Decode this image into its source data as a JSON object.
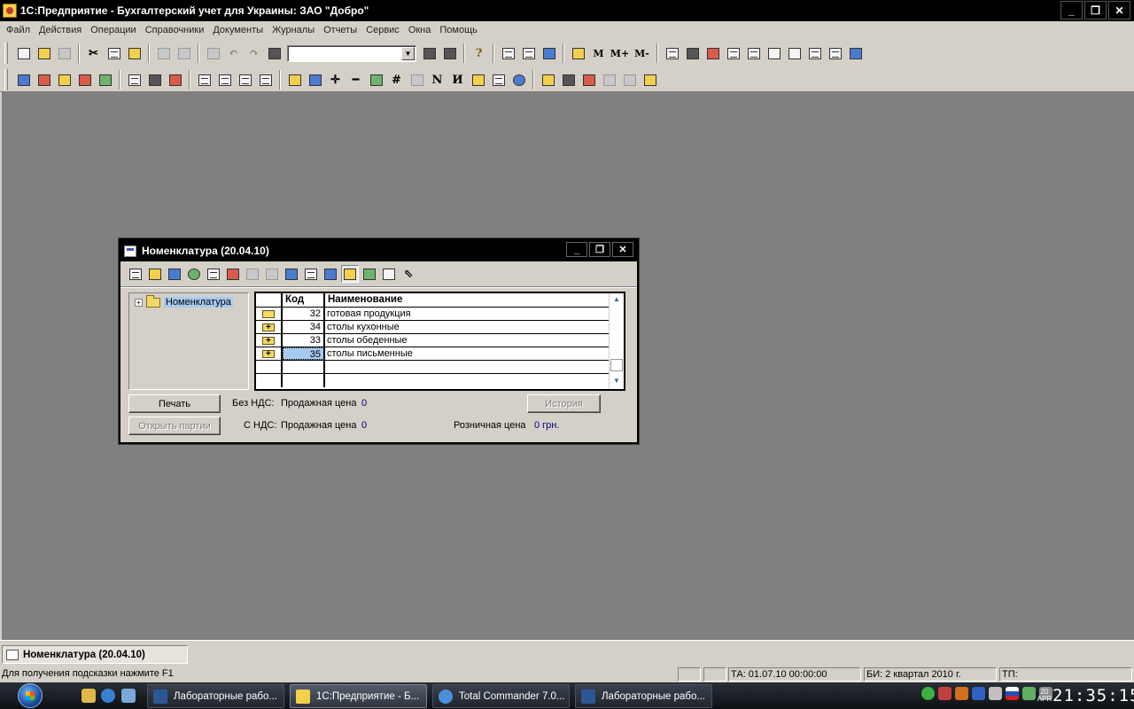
{
  "app": {
    "title": "1С:Предприятие - Бухгалтерский учет для Украины: ЗАО \"Добро\"",
    "window_buttons": [
      "_",
      "❐",
      "✕"
    ]
  },
  "menu": [
    "Файл",
    "Действия",
    "Операции",
    "Справочники",
    "Документы",
    "Журналы",
    "Отчеты",
    "Сервис",
    "Окна",
    "Помощь"
  ],
  "toolbar": {
    "m_buttons": [
      "M",
      "M+",
      "M-"
    ],
    "help_glyph": "?",
    "search_value": ""
  },
  "child_window": {
    "title": "Номенклатура (20.04.10)",
    "buttons": [
      "_",
      "❐",
      "✕"
    ],
    "tree": {
      "expander": "+",
      "root_label": "Номенклатура"
    },
    "grid": {
      "headers": [
        "",
        "Код",
        "Наименование"
      ],
      "rows": [
        {
          "icon": "open-folder-icon",
          "code": "32",
          "name": "готовая продукция"
        },
        {
          "icon": "folder-plus-icon",
          "code": "34",
          "name": "столы кухонные"
        },
        {
          "icon": "folder-plus-icon",
          "code": "33",
          "name": "столы обеденные"
        },
        {
          "icon": "folder-plus-icon",
          "code": "35",
          "name": "столы письменные"
        }
      ]
    },
    "buttons_bottom": {
      "print": "Печать",
      "open_batches": "Открыть партии",
      "history": "История"
    },
    "info": {
      "no_vat_label": "Без НДС:",
      "with_vat_label": "С НДС:",
      "sale_price_label": "Продажная цена",
      "no_vat_value": "0",
      "with_vat_value": "0",
      "retail_label": "Розничная цена",
      "retail_value": "0 грн."
    }
  },
  "mdi_tab": "Номенклатура (20.04.10)",
  "statusbar": {
    "hint": "Для получения подсказки нажмите F1",
    "ta": "ТА: 01.07.10  00:00:00",
    "bi": "БИ: 2 квартал 2010 г.",
    "tp": "ТП:"
  },
  "taskbar": {
    "tasks": [
      {
        "label": "Лабораторные рабо...",
        "active": false
      },
      {
        "label": "1С:Предприятие - Б...",
        "active": true
      },
      {
        "label": "Total Commander 7.0...",
        "active": false
      },
      {
        "label": "Лабораторные рабо...",
        "active": false
      }
    ],
    "clock_date": "20 APR",
    "clock_time": "21:35:15"
  },
  "colors": {
    "desktop": "#808080",
    "chrome": "#d4d0c8",
    "selection": "#a6caf0",
    "value_text": "#000080"
  }
}
